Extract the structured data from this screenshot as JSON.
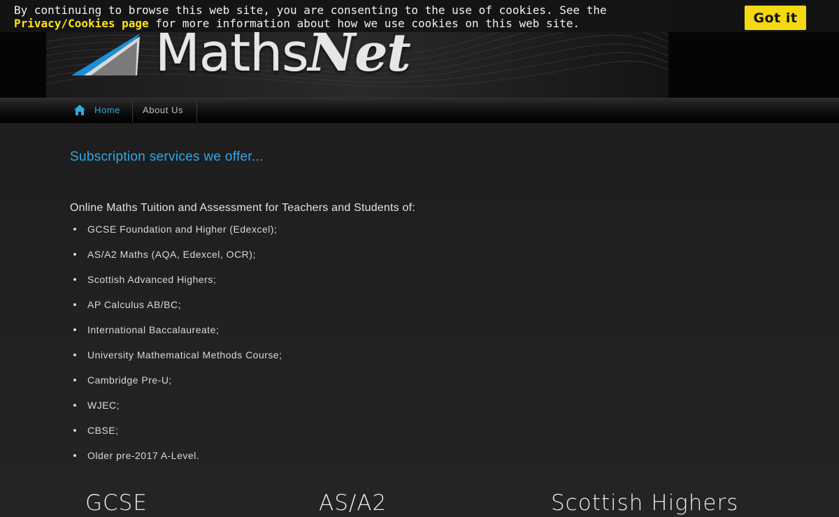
{
  "cookie_banner": {
    "text_before": "By continuing to browse this web site, you are consenting to the use of cookies. See the ",
    "link_label": "Privacy/Cookies page",
    "text_after": " for more information about how we use cookies on this web site.",
    "accept_label": "Got it",
    "link_color": "#ffe41a",
    "button_color": "#f4d812"
  },
  "logo": {
    "prefix": "Maths",
    "suffix": "Net",
    "icon": "triangle-logo-icon"
  },
  "nav": {
    "items": [
      {
        "label": "Home",
        "icon": "home-icon",
        "active": true
      },
      {
        "label": "About Us"
      }
    ],
    "active_color": "#2fa7e8"
  },
  "main": {
    "section_title": "Subscription services we offer...",
    "intro": "Online Maths Tuition and Assessment for Teachers and Students of:",
    "courses": [
      "GCSE Foundation and Higher (Edexcel);",
      "AS/A2 Maths (AQA, Edexcel, OCR);",
      "Scottish Advanced Highers;",
      "AP Calculus AB/BC;",
      "International Baccalaureate;",
      "University Mathematical Methods Course;",
      "Cambridge Pre-U;",
      "WJEC;",
      "CBSE;",
      "Older pre-2017 A-Level."
    ],
    "products": [
      "GCSE",
      "AS/A2",
      "Scottish Highers"
    ]
  }
}
